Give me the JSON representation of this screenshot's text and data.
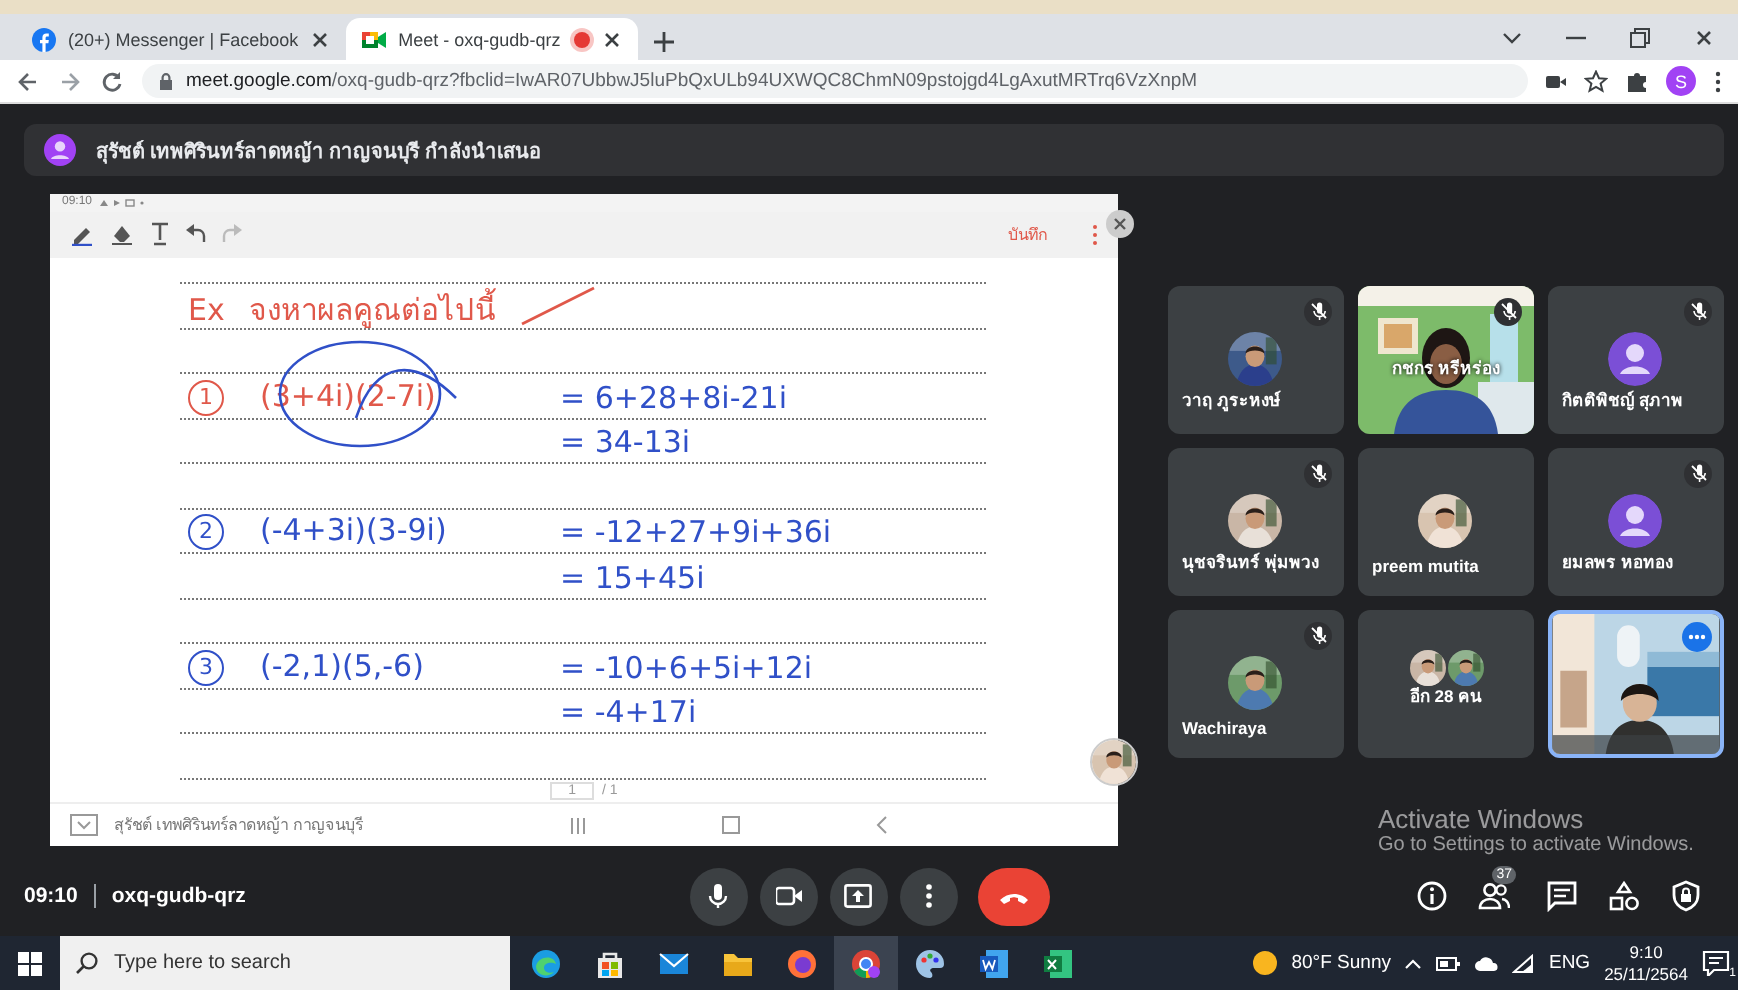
{
  "browser": {
    "tabs": [
      {
        "title": "(20+) Messenger | Facebook",
        "selected": false,
        "recording": false
      },
      {
        "title": "Meet - oxq-gudb-qrz",
        "selected": true,
        "recording": true
      }
    ],
    "url_host": "meet.google.com",
    "url_path": "/oxq-gudb-qrz?fbclid=IwAR07UbbwJ5luPbQxULb94UXWQC8ChmN09pstojgd4LgAxutMRTrq6VzXnpM",
    "profile_initial": "S"
  },
  "meet": {
    "presenting_banner": "สุรัชต์ เทพศิรินทร์ลาดหญ้า กาญจนบุรี กำลังนำเสนอ",
    "presentation": {
      "status_time": "09:10",
      "save_label": "บันทึก",
      "heading_mark": "Ex",
      "heading": "จงหาผลคูณต่อไปนี้",
      "problems": [
        {
          "number": "1",
          "expression": "(3+4i)(2-7i)",
          "color": "#e0584a",
          "marked": true,
          "steps": [
            "= 6+28+8i-21i",
            "= 34-13i"
          ]
        },
        {
          "number": "2",
          "expression": "(-4+3i)(3-9i)",
          "color": "#3050c8",
          "marked": false,
          "steps": [
            "= -12+27+9i+36i",
            "= 15+45i"
          ]
        },
        {
          "number": "3",
          "expression": "(-2,1)(5,-6)",
          "color": "#3050c8",
          "marked": false,
          "steps": [
            "= -10+6+5i+12i",
            "= -4+17i"
          ]
        }
      ],
      "page": "1",
      "page_total": "/ 1",
      "presenter_caption": "สุรัชต์ เทพศิรินทร์ลาดหญ้า กาญจนบุรี"
    },
    "tiles": [
      {
        "name": "วาฤ ภูระหงษ์",
        "muted": true
      },
      {
        "name": "กชกร หรีหร่อง",
        "kind": "video",
        "muted": true
      },
      {
        "name": "กิตติพิชญ์ สุภาพ",
        "kind": "initial",
        "muted": true
      },
      {
        "name": "นุชจรินทร์ พุ่มพวง",
        "muted": true
      },
      {
        "name": "preem mutita",
        "muted": false
      },
      {
        "name": "ยมลพร หอทอง",
        "kind": "initial",
        "muted": true
      },
      {
        "name": "Wachiraya",
        "muted": true
      },
      {
        "name": "อีก 28 คน",
        "kind": "others",
        "muted": false
      },
      {
        "kind": "self",
        "muted": false
      }
    ],
    "meeting_time": "09:10",
    "meeting_code": "oxq-gudb-qrz",
    "participant_count": "37"
  },
  "os_notice": {
    "title": "Activate Windows",
    "text": "Go to Settings to activate Windows."
  },
  "taskbar": {
    "search_placeholder": "Type here to search",
    "weather": "80°F  Sunny",
    "language": "ENG",
    "time": "9:10",
    "date": "25/11/2564",
    "notification_count": "1"
  }
}
